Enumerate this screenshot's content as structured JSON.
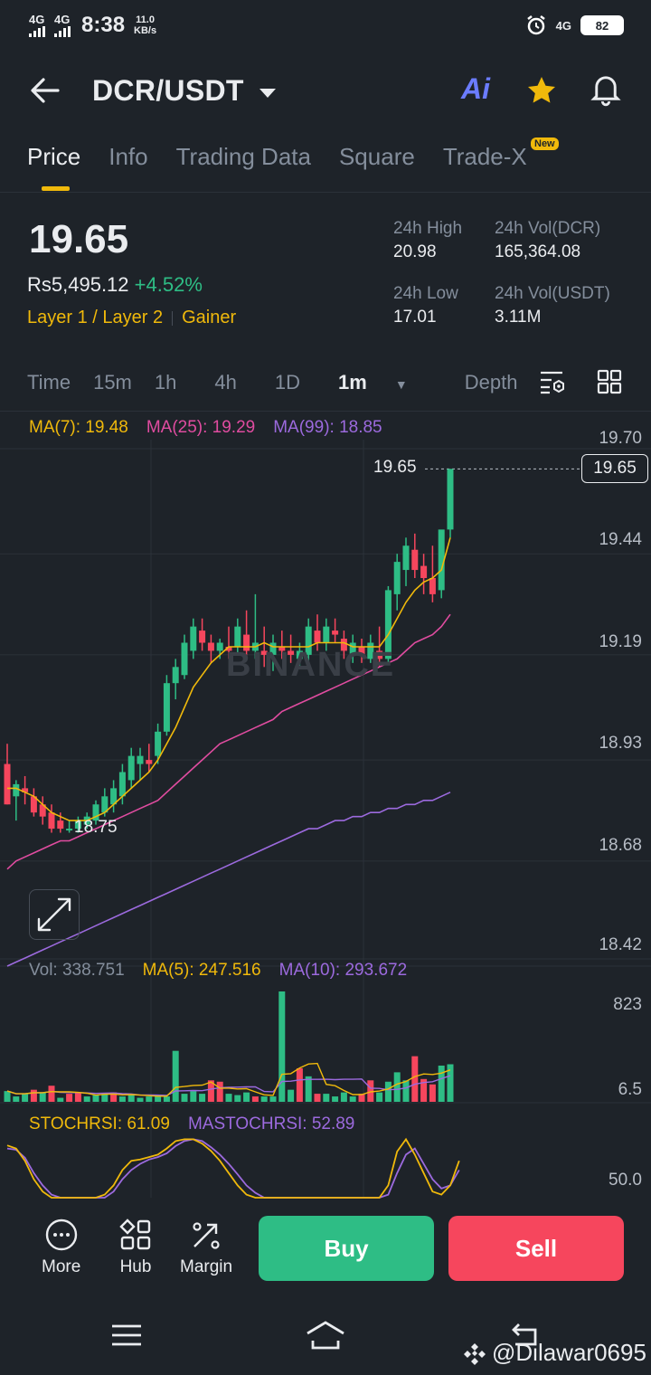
{
  "status_bar": {
    "signal1": "4G",
    "signal2": "4G",
    "time": "8:38",
    "speed_value": "11.0",
    "speed_unit": "KB/s",
    "network_right": "4G",
    "battery": "82"
  },
  "header": {
    "pair": "DCR/USDT",
    "ai_label": "Ai"
  },
  "tabs": [
    {
      "label": "Price",
      "active": true
    },
    {
      "label": "Info"
    },
    {
      "label": "Trading Data"
    },
    {
      "label": "Square"
    },
    {
      "label": "Trade-X",
      "badge": "New"
    }
  ],
  "price": {
    "last": "19.65",
    "local": "Rs5,495.12",
    "change": "+4.52%",
    "tag1": "Layer 1 / Layer 2",
    "tag2": "Gainer"
  },
  "stats": {
    "high_label": "24h High",
    "high": "20.98",
    "low_label": "24h Low",
    "low": "17.01",
    "vol_dcr_label": "24h Vol(DCR)",
    "vol_dcr": "165,364.08",
    "vol_usdt_label": "24h Vol(USDT)",
    "vol_usdt": "3.11M"
  },
  "timeframes": [
    "Time",
    "15m",
    "1h",
    "4h",
    "1D",
    "1m",
    "Depth"
  ],
  "selected_timeframe": "1m",
  "chart_data": {
    "type": "candlestick",
    "ma": {
      "ma7": "MA(7): 19.48",
      "ma25": "MA(25): 19.29",
      "ma99": "MA(99): 18.85"
    },
    "y_ticks": [
      "19.70",
      "19.44",
      "19.19",
      "18.93",
      "18.68",
      "18.42"
    ],
    "ylim": [
      18.42,
      19.7
    ],
    "current_price": "19.65",
    "high_marker": "19.65",
    "low_marker": "18.75",
    "watermark": "BINANCE",
    "colors": {
      "up": "#2ebd85",
      "down": "#f6465d",
      "ma7": "#f0b90b",
      "ma25": "#e04ca0",
      "ma99": "#9c6ade"
    },
    "candles": [
      [
        18.92,
        18.97,
        18.82,
        18.82
      ],
      [
        18.84,
        18.88,
        18.78,
        18.87
      ],
      [
        18.86,
        18.89,
        18.82,
        18.85
      ],
      [
        18.84,
        18.86,
        18.79,
        18.8
      ],
      [
        18.82,
        18.84,
        18.77,
        18.79
      ],
      [
        18.8,
        18.82,
        18.75,
        18.76
      ],
      [
        18.78,
        18.8,
        18.75,
        18.76
      ],
      [
        18.76,
        18.78,
        18.75,
        18.76
      ],
      [
        18.76,
        18.79,
        18.75,
        18.78
      ],
      [
        18.77,
        18.8,
        18.76,
        18.79
      ],
      [
        18.78,
        18.83,
        18.77,
        18.82
      ],
      [
        18.8,
        18.86,
        18.79,
        18.84
      ],
      [
        18.82,
        18.88,
        18.8,
        18.86
      ],
      [
        18.84,
        18.92,
        18.82,
        18.9
      ],
      [
        18.88,
        18.96,
        18.86,
        18.94
      ],
      [
        18.92,
        18.96,
        18.88,
        18.94
      ],
      [
        18.93,
        18.97,
        18.9,
        18.92
      ],
      [
        18.94,
        19.02,
        18.92,
        19.0
      ],
      [
        19.0,
        19.14,
        18.99,
        19.12
      ],
      [
        19.12,
        19.18,
        19.08,
        19.16
      ],
      [
        19.14,
        19.24,
        19.13,
        19.22
      ],
      [
        19.2,
        19.28,
        19.18,
        19.26
      ],
      [
        19.25,
        19.28,
        19.2,
        19.22
      ],
      [
        19.22,
        19.24,
        19.17,
        19.2
      ],
      [
        19.2,
        19.23,
        19.18,
        19.22
      ],
      [
        19.21,
        19.26,
        19.18,
        19.2
      ],
      [
        19.21,
        19.28,
        19.19,
        19.26
      ],
      [
        19.24,
        19.3,
        19.18,
        19.2
      ],
      [
        19.2,
        19.34,
        19.18,
        19.22
      ],
      [
        19.2,
        19.26,
        19.16,
        19.19
      ],
      [
        19.19,
        19.24,
        19.15,
        19.22
      ],
      [
        19.21,
        19.25,
        19.18,
        19.2
      ],
      [
        19.2,
        19.24,
        19.17,
        19.19
      ],
      [
        19.18,
        19.22,
        19.16,
        19.2
      ],
      [
        19.19,
        19.28,
        19.17,
        19.26
      ],
      [
        19.25,
        19.29,
        19.2,
        19.22
      ],
      [
        19.22,
        19.28,
        19.2,
        19.26
      ],
      [
        19.25,
        19.28,
        19.22,
        19.24
      ],
      [
        19.23,
        19.25,
        19.18,
        19.2
      ],
      [
        19.19,
        19.24,
        19.17,
        19.22
      ],
      [
        19.21,
        19.23,
        19.17,
        19.19
      ],
      [
        19.18,
        19.24,
        19.17,
        19.22
      ],
      [
        19.2,
        19.26,
        19.16,
        19.18
      ],
      [
        19.18,
        19.36,
        19.17,
        19.35
      ],
      [
        19.34,
        19.44,
        19.3,
        19.42
      ],
      [
        19.4,
        19.48,
        19.36,
        19.46
      ],
      [
        19.45,
        19.49,
        19.38,
        19.4
      ],
      [
        19.41,
        19.44,
        19.34,
        19.38
      ],
      [
        19.38,
        19.46,
        19.32,
        19.34
      ],
      [
        19.35,
        19.45,
        19.33,
        19.5
      ],
      [
        19.5,
        19.65,
        19.48,
        19.65
      ]
    ],
    "ma7_line": [
      18.86,
      18.86,
      18.85,
      18.84,
      18.82,
      18.8,
      18.79,
      18.78,
      18.78,
      18.78,
      18.79,
      18.8,
      18.82,
      18.84,
      18.86,
      18.88,
      18.9,
      18.93,
      18.97,
      19.01,
      19.06,
      19.11,
      19.14,
      19.17,
      19.19,
      19.21,
      19.21,
      19.21,
      19.21,
      19.22,
      19.21,
      19.21,
      19.21,
      19.21,
      19.21,
      19.22,
      19.22,
      19.22,
      19.22,
      19.21,
      19.21,
      19.21,
      19.21,
      19.24,
      19.28,
      19.32,
      19.35,
      19.37,
      19.38,
      19.4,
      19.48
    ],
    "ma25_line": [
      18.66,
      18.68,
      18.69,
      18.7,
      18.71,
      18.72,
      18.73,
      18.73,
      18.74,
      18.75,
      18.76,
      18.77,
      18.78,
      18.79,
      18.8,
      18.81,
      18.82,
      18.83,
      18.85,
      18.87,
      18.89,
      18.91,
      18.93,
      18.95,
      18.97,
      18.98,
      18.99,
      19.0,
      19.01,
      19.02,
      19.03,
      19.05,
      19.06,
      19.07,
      19.08,
      19.09,
      19.1,
      19.11,
      19.12,
      19.13,
      19.14,
      19.15,
      19.16,
      19.17,
      19.18,
      19.2,
      19.22,
      19.23,
      19.24,
      19.26,
      19.29
    ],
    "ma99_line": [
      18.42,
      18.43,
      18.44,
      18.45,
      18.46,
      18.47,
      18.48,
      18.49,
      18.5,
      18.51,
      18.52,
      18.53,
      18.54,
      18.55,
      18.56,
      18.57,
      18.58,
      18.59,
      18.6,
      18.61,
      18.62,
      18.63,
      18.64,
      18.65,
      18.66,
      18.67,
      18.68,
      18.69,
      18.7,
      18.71,
      18.72,
      18.73,
      18.74,
      18.75,
      18.76,
      18.76,
      18.77,
      18.78,
      18.78,
      18.79,
      18.79,
      18.8,
      18.8,
      18.81,
      18.81,
      18.82,
      18.82,
      18.83,
      18.83,
      18.84,
      18.85
    ],
    "volume": {
      "label": "Vol: 338.751",
      "ma5": "MA(5): 247.516",
      "ma10": "MA(10): 293.672",
      "ticks": [
        "823",
        "6.5"
      ],
      "ylim": [
        0,
        823
      ],
      "bars": [
        80,
        40,
        60,
        90,
        70,
        120,
        30,
        60,
        70,
        40,
        50,
        60,
        70,
        40,
        50,
        30,
        40,
        50,
        40,
        380,
        60,
        80,
        60,
        160,
        150,
        60,
        50,
        70,
        40,
        40,
        40,
        840,
        90,
        250,
        190,
        60,
        60,
        40,
        70,
        40,
        60,
        160,
        70,
        150,
        220,
        160,
        340,
        170,
        130,
        270,
        280
      ],
      "down_indices": [
        3,
        5,
        7,
        8,
        12,
        23,
        24,
        28,
        33,
        35,
        40,
        41,
        46,
        47,
        48
      ]
    },
    "stochrsi": {
      "label": "STOCHRSI: 61.09",
      "mastochrsi": "MASTOCHRSI: 52.89",
      "tick": "50.0",
      "k": [
        85,
        80,
        60,
        30,
        10,
        0,
        0,
        0,
        0,
        0,
        0,
        5,
        20,
        45,
        60,
        62,
        66,
        70,
        80,
        92,
        95,
        95,
        88,
        76,
        60,
        40,
        20,
        5,
        0,
        0,
        0,
        0,
        0,
        0,
        0,
        0,
        0,
        0,
        0,
        0,
        0,
        0,
        0,
        20,
        75,
        95,
        70,
        40,
        10,
        5,
        20,
        60
      ],
      "d": [
        80,
        78,
        65,
        40,
        20,
        5,
        0,
        0,
        0,
        0,
        0,
        0,
        10,
        30,
        45,
        55,
        62,
        66,
        72,
        84,
        92,
        95,
        92,
        82,
        70,
        55,
        38,
        20,
        8,
        0,
        0,
        0,
        0,
        0,
        0,
        0,
        0,
        0,
        0,
        0,
        0,
        0,
        0,
        5,
        40,
        70,
        80,
        55,
        30,
        15,
        20,
        45
      ]
    }
  },
  "actions": {
    "more": "More",
    "hub": "Hub",
    "margin": "Margin",
    "buy": "Buy",
    "sell": "Sell"
  },
  "watermark": "@Dilawar0695"
}
